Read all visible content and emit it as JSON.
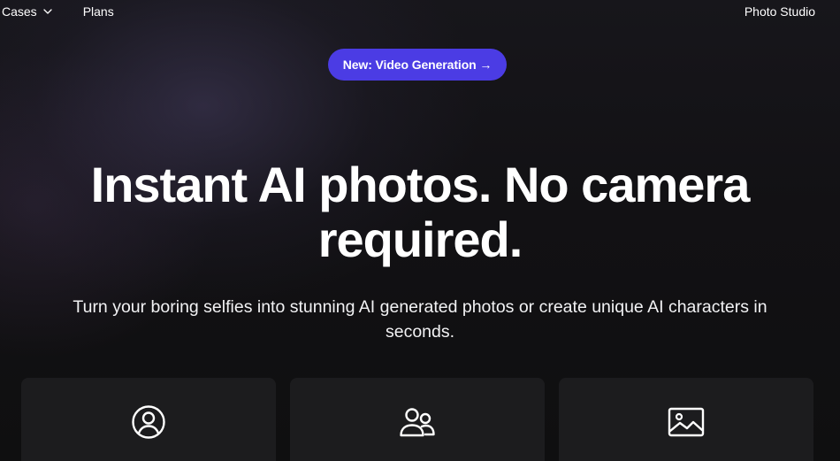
{
  "nav": {
    "cases_label": "Cases",
    "plans_label": "Plans",
    "photo_studio_label": "Photo Studio"
  },
  "hero": {
    "badge_label": "New: Video Generation →",
    "headline_line1": "Instant AI photos. No camera",
    "headline_line2": "required.",
    "subtitle_line1": "Turn your boring selfies into stunning AI generated photos or create unique AI characters in",
    "subtitle_line2": "seconds."
  },
  "cards": [
    {
      "icon": "user-circle-icon"
    },
    {
      "icon": "users-icon"
    },
    {
      "icon": "image-icon"
    }
  ],
  "colors": {
    "accent": "#4b3ce4",
    "background": "#101012",
    "card": "#1c1c1e",
    "text": "#ffffff"
  }
}
